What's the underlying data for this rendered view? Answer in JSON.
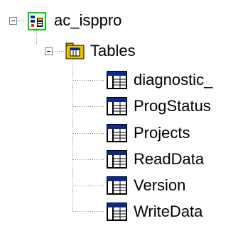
{
  "tree": {
    "root": {
      "label": "ac_isppro",
      "icon": "database-icon",
      "expanded": true
    },
    "folder": {
      "label": "Tables",
      "icon": "folder-icon",
      "expanded": true
    },
    "tables": [
      {
        "label": "diagnostic_",
        "icon": "table-icon"
      },
      {
        "label": "ProgStatus",
        "icon": "table-icon"
      },
      {
        "label": "Projects",
        "icon": "table-icon"
      },
      {
        "label": "ReadData",
        "icon": "table-icon"
      },
      {
        "label": "Version",
        "icon": "table-icon"
      },
      {
        "label": "WriteData",
        "icon": "table-icon"
      }
    ],
    "colors": {
      "selection_outline": "#00d000",
      "folder": "#e8c200",
      "table_header": "#0b2a8c",
      "connector": "#808080"
    }
  }
}
